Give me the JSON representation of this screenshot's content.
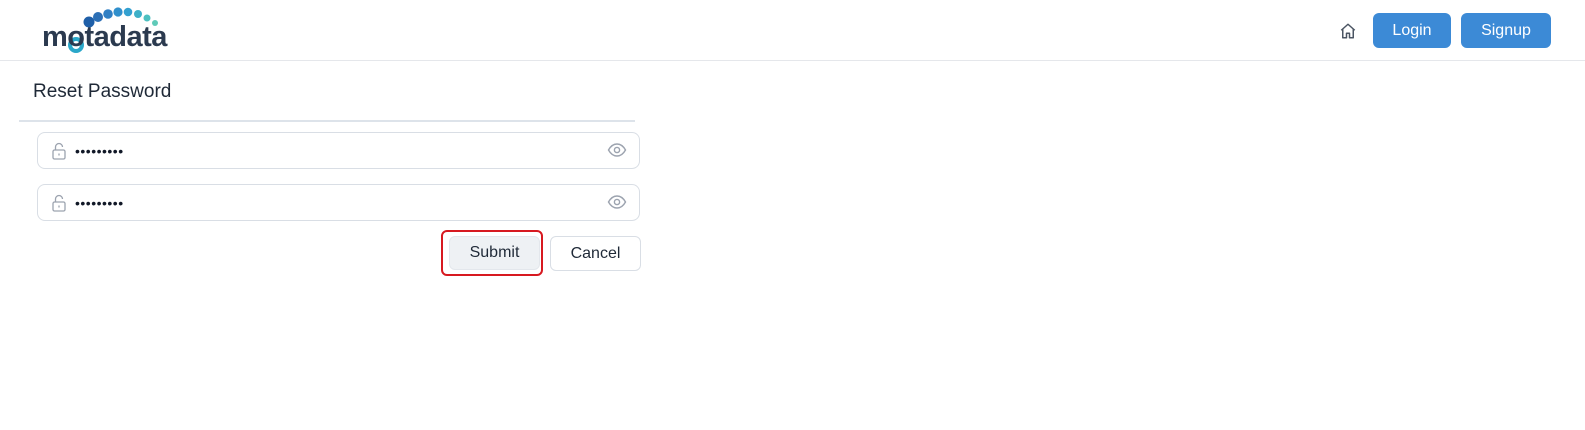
{
  "header": {
    "logo_text": "motadata",
    "nav": {
      "home_icon": "home-icon",
      "login_label": "Login",
      "signup_label": "Signup"
    }
  },
  "form": {
    "title": "Reset Password",
    "new_password": {
      "value": "•••••••••",
      "icon": "lock-icon",
      "toggle_icon": "eye-icon"
    },
    "confirm_password": {
      "value": "•••••••••",
      "icon": "lock-icon",
      "toggle_icon": "eye-icon"
    },
    "submit_label": "Submit",
    "cancel_label": "Cancel"
  },
  "colors": {
    "primary": "#3c8ad6",
    "highlight_outline": "#d71920",
    "logo_text": "#2b3a4f"
  }
}
